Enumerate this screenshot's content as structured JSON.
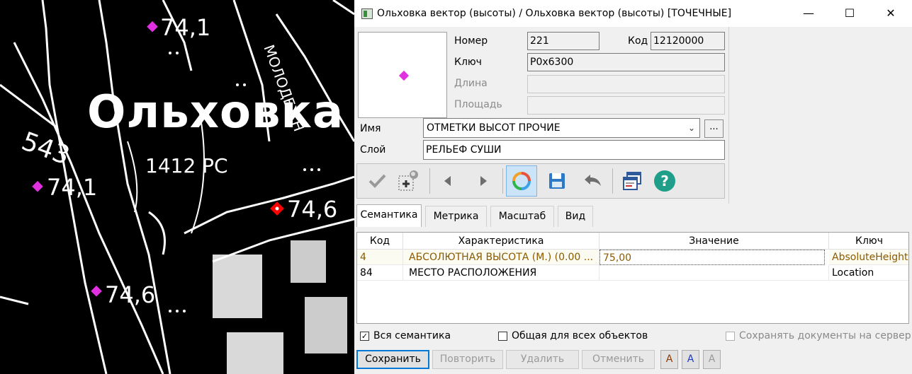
{
  "map": {
    "labels": {
      "place_name": "Ольховка",
      "code": "1412 РС",
      "number": "543",
      "street": "МОЛОДЕЖН",
      "h1": "74,1",
      "h2": "74,1",
      "h3": "74,6",
      "h4": "74,6"
    }
  },
  "window": {
    "title": "Ольховка вектор (высоты) / Ольховка вектор (высоты) [ТОЧЕЧНЫЕ]",
    "controls": {
      "minimize": "—",
      "maximize": "☐",
      "close": "✕"
    }
  },
  "object": {
    "number_label": "Номер",
    "number_value": "221",
    "code_label": "Код",
    "code_value": "12120000",
    "key_label": "Ключ",
    "key_value": "P0x6300",
    "length_label": "Длина",
    "area_label": "Площадь",
    "name_label": "Имя",
    "name_value": "ОТМЕТКИ ВЫСОТ ПРОЧИЕ",
    "name_button": "...",
    "layer_label": "Слой",
    "layer_value": "РЕЛЬЕФ СУШИ"
  },
  "toolbar": {
    "icons": [
      "checkmark-icon",
      "add-point-icon",
      "arrow-left-icon",
      "arrow-right-icon",
      "refresh-icon",
      "save-icon",
      "undo-icon",
      "window-icon",
      "help-icon"
    ]
  },
  "tabs": [
    "Семантика",
    "Метрика",
    "Масштаб",
    "Вид"
  ],
  "table": {
    "columns": [
      "Код",
      "Характеристика",
      "Значение",
      "Ключ"
    ],
    "rows": [
      {
        "code": "4",
        "char": "АБСОЛЮТНАЯ ВЫСОТА (М.)  (0.00 ...",
        "value": "75,00",
        "key": "AbsoluteHeight"
      },
      {
        "code": "84",
        "char": "МЕСТО РАСПОЛОЖЕНИЯ",
        "value": "",
        "key": "Location"
      }
    ]
  },
  "checks": {
    "all_semantics": "Вся семантика",
    "all_semantics_checked": true,
    "common": "Общая для всех объектов",
    "common_checked": false,
    "save_docs": "Сохранять документы на сервер",
    "save_docs_checked": false
  },
  "buttons": {
    "save": "Сохранить",
    "repeat": "Повторить",
    "delete": "Удалить",
    "cancel": "Отменить",
    "font_a1": "A",
    "font_a2": "A",
    "font_a3": "A"
  },
  "colors": {
    "accent": "#0078d7",
    "brown_text": "#8b5a00",
    "magenta_marker": "#e030e0",
    "red_marker": "#ff0000"
  }
}
